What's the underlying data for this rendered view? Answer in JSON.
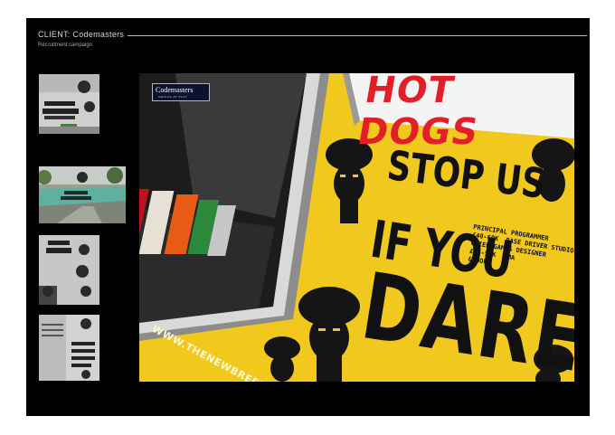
{
  "header": {
    "client_title": "CLIENT: Codemasters",
    "subtitle": "Recruitment campaign"
  },
  "thumbnails": [
    {
      "name": "thumb-wish-granted"
    },
    {
      "name": "thumb-path-to-glory"
    },
    {
      "name": "thumb-route-to-the-top"
    },
    {
      "name": "thumb-nothing-can-stop-us"
    }
  ],
  "hero": {
    "brand_logo": "Codemasters",
    "brand_tagline": "GENIUS AT PLAY",
    "headline_top": "HOT DOGS",
    "stop_line": "STOP US",
    "if_line": "IF YOU",
    "dare_line": "DARE",
    "jobs_text": "PRINCIPAL PROGRAMMER\n£40-60K  BASE DRIVER STUDIO\nCHIEF GAMES DESIGNER\n£35-55K  LMA\n& MORE",
    "url": "WWW.THENEWBREED.INFO"
  },
  "colors": {
    "background": "#000000",
    "van_yellow": "#f0c81e",
    "headline_red": "#e01f26",
    "stencil_black": "#111111"
  }
}
